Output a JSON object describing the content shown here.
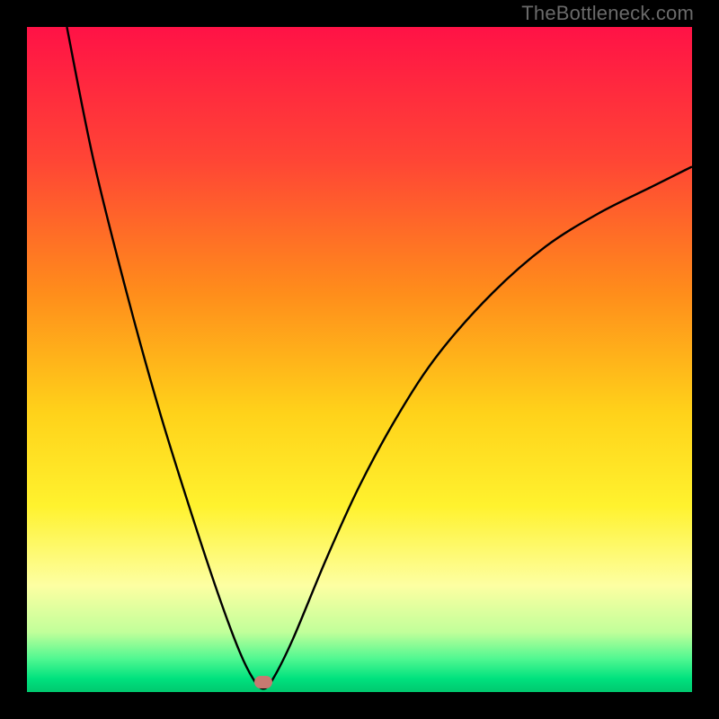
{
  "attribution": {
    "text": "TheBottleneck.com"
  },
  "chart_data": {
    "type": "line",
    "title": "",
    "xlabel": "",
    "ylabel": "",
    "ylim": [
      0,
      100
    ],
    "xlim": [
      0,
      100
    ],
    "curve_points": [
      {
        "x": 6,
        "y": 100
      },
      {
        "x": 10,
        "y": 80
      },
      {
        "x": 15,
        "y": 60
      },
      {
        "x": 20,
        "y": 42
      },
      {
        "x": 25,
        "y": 26
      },
      {
        "x": 29,
        "y": 14
      },
      {
        "x": 32,
        "y": 6
      },
      {
        "x": 34,
        "y": 2
      },
      {
        "x": 35.5,
        "y": 0.5
      },
      {
        "x": 37,
        "y": 2
      },
      {
        "x": 40,
        "y": 8
      },
      {
        "x": 45,
        "y": 20
      },
      {
        "x": 50,
        "y": 31
      },
      {
        "x": 56,
        "y": 42
      },
      {
        "x": 62,
        "y": 51
      },
      {
        "x": 70,
        "y": 60
      },
      {
        "x": 78,
        "y": 67
      },
      {
        "x": 86,
        "y": 72
      },
      {
        "x": 94,
        "y": 76
      },
      {
        "x": 100,
        "y": 79
      }
    ],
    "minimum_marker": {
      "x": 35.5,
      "y": 1.5
    },
    "gradient_stops": [
      {
        "offset": 0,
        "color": "#ff1246"
      },
      {
        "offset": 20,
        "color": "#ff4535"
      },
      {
        "offset": 40,
        "color": "#ff8d1b"
      },
      {
        "offset": 58,
        "color": "#ffd21a"
      },
      {
        "offset": 72,
        "color": "#fff22e"
      },
      {
        "offset": 84,
        "color": "#fdffa2"
      },
      {
        "offset": 91,
        "color": "#c1ff9a"
      },
      {
        "offset": 95,
        "color": "#50f891"
      },
      {
        "offset": 98,
        "color": "#00e17e"
      },
      {
        "offset": 100,
        "color": "#00c86f"
      }
    ]
  }
}
